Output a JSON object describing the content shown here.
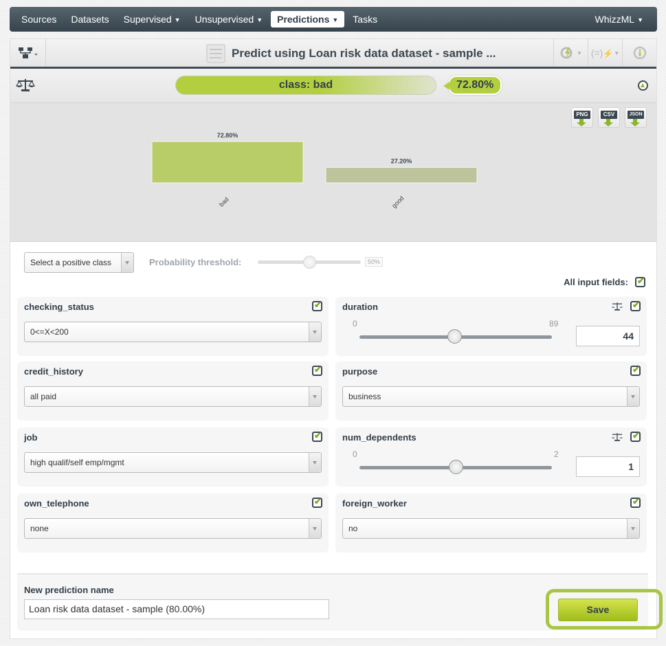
{
  "nav": {
    "items": [
      {
        "label": "Sources",
        "dropdown": false,
        "active": false
      },
      {
        "label": "Datasets",
        "dropdown": false,
        "active": false
      },
      {
        "label": "Supervised",
        "dropdown": true,
        "active": false
      },
      {
        "label": "Unsupervised",
        "dropdown": true,
        "active": false
      },
      {
        "label": "Predictions",
        "dropdown": true,
        "active": true
      },
      {
        "label": "Tasks",
        "dropdown": false,
        "active": false
      }
    ],
    "right_item": {
      "label": "WhizzML",
      "dropdown": true
    }
  },
  "toolbar": {
    "title": "Predict using Loan risk data dataset - sample ...",
    "left_icon": "model-tree-icon",
    "right_icons": [
      "lightning-cycle-icon",
      "formula-lightning-icon",
      "info-icon"
    ]
  },
  "result": {
    "class_label": "class: bad",
    "confidence": "72.80%",
    "confidence_value": 0.728,
    "accent_color": "#b3cf3f"
  },
  "downloads": [
    "PNG",
    "CSV",
    "JSON"
  ],
  "chart_data": {
    "type": "bar",
    "categories": [
      "bad",
      "good"
    ],
    "values": [
      72.8,
      27.2
    ],
    "labels": [
      "72.80%",
      "27.20%"
    ],
    "colors": [
      "#b8cc68",
      "#bdc49c"
    ],
    "title": "",
    "xlabel": "",
    "ylabel": "",
    "ylim": [
      0,
      100
    ],
    "grid": false
  },
  "controls": {
    "positive_class_placeholder": "Select a positive class",
    "threshold_label": "Probability threshold:",
    "threshold_value": "50%",
    "threshold_fraction": 0.5,
    "all_fields_label": "All input fields:",
    "all_fields_checked": true
  },
  "fields": [
    {
      "name": "checking_status",
      "type": "categorical",
      "value": "0<=X<200",
      "checked": true
    },
    {
      "name": "duration",
      "type": "numeric",
      "min": "0",
      "max": "89",
      "value": "44",
      "fraction": 0.4944,
      "checked": true
    },
    {
      "name": "credit_history",
      "type": "categorical",
      "value": "all paid",
      "checked": true
    },
    {
      "name": "purpose",
      "type": "categorical",
      "value": "business",
      "checked": true
    },
    {
      "name": "job",
      "type": "categorical",
      "value": "high qualif/self emp/mgmt",
      "checked": true
    },
    {
      "name": "num_dependents",
      "type": "numeric",
      "min": "0",
      "max": "2",
      "value": "1",
      "fraction": 0.5,
      "checked": true
    },
    {
      "name": "own_telephone",
      "type": "categorical",
      "value": "none",
      "checked": true
    },
    {
      "name": "foreign_worker",
      "type": "categorical",
      "value": "no",
      "checked": true
    }
  ],
  "footer": {
    "name_label": "New prediction name",
    "name_value": "Loan risk data dataset - sample (80.00%)",
    "save_label": "Save"
  }
}
